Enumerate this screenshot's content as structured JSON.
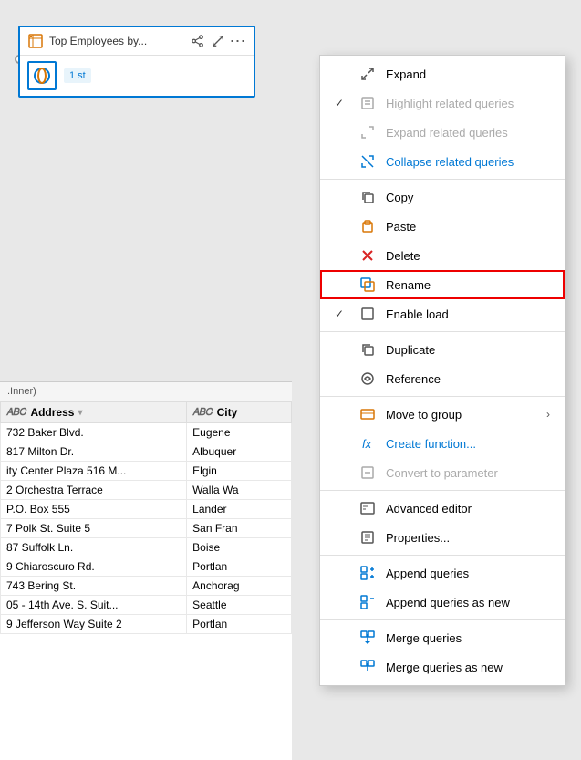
{
  "canvas": {
    "background": "#e8e8e8"
  },
  "queryCard": {
    "title": "Top Employees by...",
    "stepBadge": "1 st",
    "shareIcon": "share-icon",
    "expandIcon": "expand-icon",
    "moreIcon": "more-icon"
  },
  "joinLabel": ".Inner)",
  "tableColumns": [
    {
      "name": "Address",
      "type": "ABC",
      "hasDropdown": true
    },
    {
      "name": "City",
      "type": "ABC",
      "hasDropdown": false
    }
  ],
  "tableRows": [
    [
      "732 Baker Blvd.",
      "Eugene"
    ],
    [
      "817 Milton Dr.",
      "Albuquer"
    ],
    [
      "ity Center Plaza 516 M...",
      "Elgin"
    ],
    [
      "2 Orchestra Terrace",
      "Walla Wa"
    ],
    [
      "P.O. Box 555",
      "Lander"
    ],
    [
      "7 Polk St. Suite 5",
      "San Fran"
    ],
    [
      "87 Suffolk Ln.",
      "Boise"
    ],
    [
      "9 Chiaroscuro Rd.",
      "Portlan"
    ],
    [
      "743 Bering St.",
      "Anchorag"
    ],
    [
      "05 - 14th Ave. S. Suit...",
      "Seattle"
    ],
    [
      "9 Jefferson Way Suite 2",
      "Portlan"
    ]
  ],
  "contextMenu": {
    "items": [
      {
        "id": "expand",
        "label": "Expand",
        "icon": "expand-menu-icon",
        "check": "",
        "disabled": false,
        "hasArrow": false
      },
      {
        "id": "highlight-related",
        "label": "Highlight related queries",
        "icon": "highlight-icon",
        "check": "✓",
        "disabled": true,
        "hasArrow": false
      },
      {
        "id": "expand-related",
        "label": "Expand related queries",
        "icon": "expand-related-icon",
        "check": "",
        "disabled": true,
        "hasArrow": false
      },
      {
        "id": "collapse-related",
        "label": "Collapse related queries",
        "icon": "collapse-related-icon",
        "check": "",
        "disabled": false,
        "hasArrow": false
      },
      {
        "id": "sep1",
        "type": "separator"
      },
      {
        "id": "copy",
        "label": "Copy",
        "icon": "copy-icon",
        "check": "",
        "disabled": false,
        "hasArrow": false
      },
      {
        "id": "paste",
        "label": "Paste",
        "icon": "paste-icon",
        "check": "",
        "disabled": false,
        "hasArrow": false
      },
      {
        "id": "delete",
        "label": "Delete",
        "icon": "delete-icon",
        "check": "",
        "disabled": false,
        "hasArrow": false
      },
      {
        "id": "rename",
        "label": "Rename",
        "icon": "rename-icon",
        "check": "",
        "disabled": false,
        "hasArrow": false,
        "highlighted": true
      },
      {
        "id": "enable-load",
        "label": "Enable load",
        "icon": "enable-load-icon",
        "check": "✓",
        "disabled": false,
        "hasArrow": false
      },
      {
        "id": "sep2",
        "type": "separator"
      },
      {
        "id": "duplicate",
        "label": "Duplicate",
        "icon": "duplicate-icon",
        "check": "",
        "disabled": false,
        "hasArrow": false
      },
      {
        "id": "reference",
        "label": "Reference",
        "icon": "reference-icon",
        "check": "",
        "disabled": false,
        "hasArrow": false
      },
      {
        "id": "sep3",
        "type": "separator"
      },
      {
        "id": "move-to-group",
        "label": "Move to group",
        "icon": "move-group-icon",
        "check": "",
        "disabled": false,
        "hasArrow": true
      },
      {
        "id": "create-function",
        "label": "Create function...",
        "icon": "function-icon",
        "check": "",
        "disabled": false,
        "hasArrow": false
      },
      {
        "id": "convert-parameter",
        "label": "Convert to parameter",
        "icon": "parameter-icon",
        "check": "",
        "disabled": true,
        "hasArrow": false
      },
      {
        "id": "sep4",
        "type": "separator"
      },
      {
        "id": "advanced-editor",
        "label": "Advanced editor",
        "icon": "editor-icon",
        "check": "",
        "disabled": false,
        "hasArrow": false
      },
      {
        "id": "properties",
        "label": "Properties...",
        "icon": "properties-icon",
        "check": "",
        "disabled": false,
        "hasArrow": false
      },
      {
        "id": "sep5",
        "type": "separator"
      },
      {
        "id": "append-queries",
        "label": "Append queries",
        "icon": "append-icon",
        "check": "",
        "disabled": false,
        "hasArrow": false
      },
      {
        "id": "append-queries-new",
        "label": "Append queries as new",
        "icon": "append-new-icon",
        "check": "",
        "disabled": false,
        "hasArrow": false
      },
      {
        "id": "sep6",
        "type": "separator"
      },
      {
        "id": "merge-queries",
        "label": "Merge queries",
        "icon": "merge-icon",
        "check": "",
        "disabled": false,
        "hasArrow": false
      },
      {
        "id": "merge-queries-new",
        "label": "Merge queries as new",
        "icon": "merge-new-icon",
        "check": "",
        "disabled": false,
        "hasArrow": false
      }
    ]
  }
}
